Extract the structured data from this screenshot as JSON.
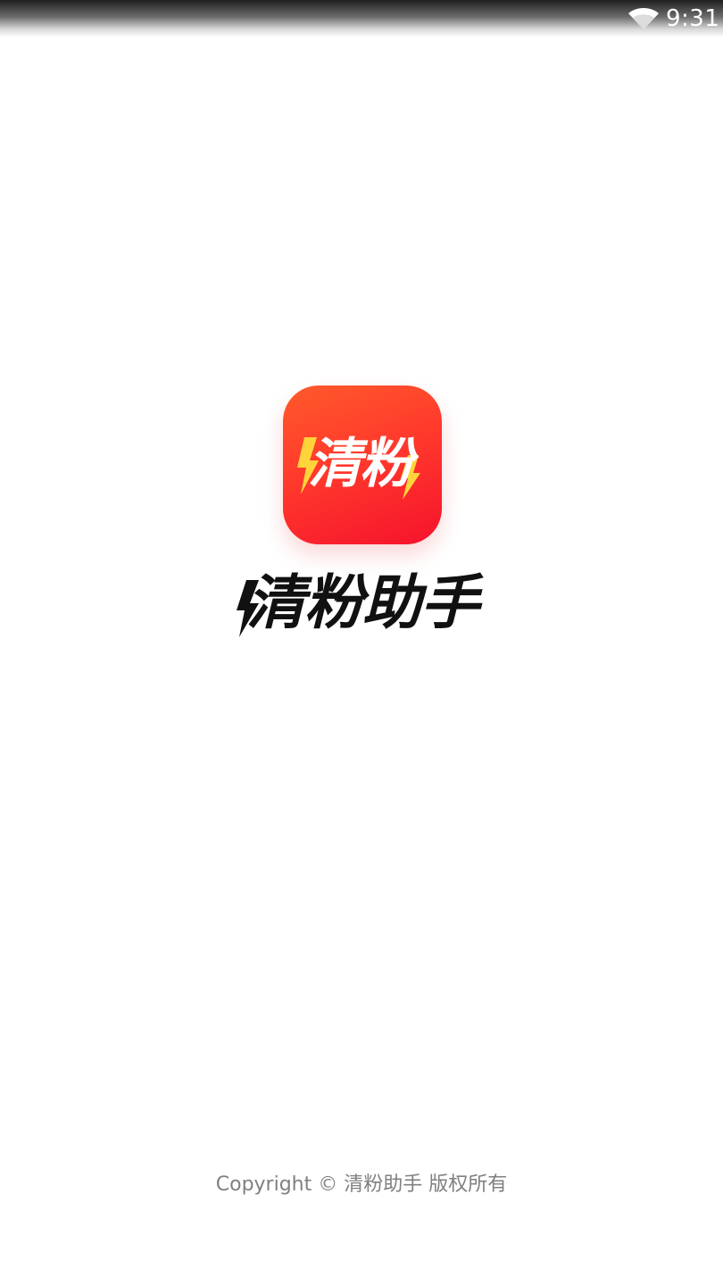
{
  "status_bar": {
    "time": "9:31",
    "icons": [
      "wifi-icon"
    ]
  },
  "app_icon": {
    "label": "清粉",
    "colors": {
      "gradient_start": "#ff5a2b",
      "gradient_end": "#f5132c",
      "bolt": "#ffd43b",
      "text": "#ffffff"
    }
  },
  "app_title": "清粉助手",
  "footer": {
    "copyright": "Copyright © 清粉助手 版权所有"
  }
}
